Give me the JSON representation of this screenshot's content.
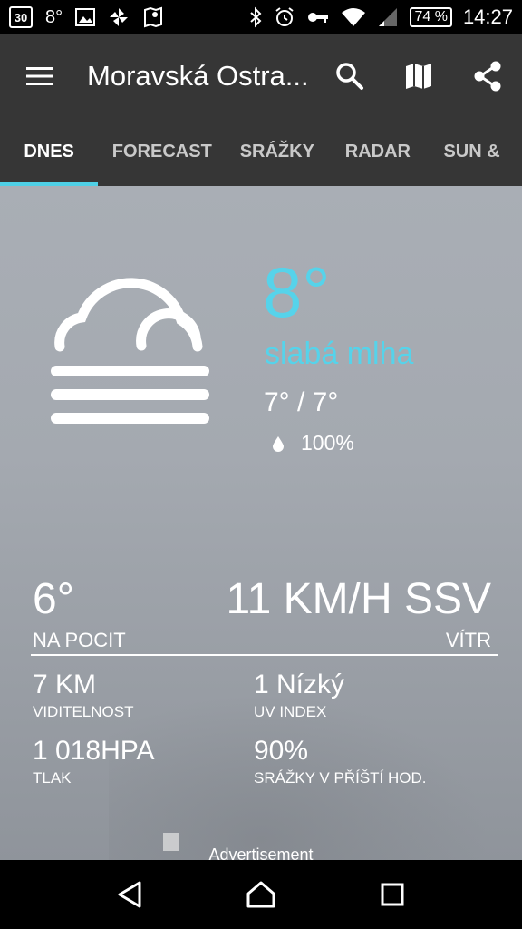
{
  "status_bar": {
    "date_badge": "30",
    "temperature": "8°",
    "battery": "74 %",
    "time": "14:27"
  },
  "app_bar": {
    "title": "Moravská Ostra...",
    "menu_icon": "hamburger-menu-icon",
    "actions": [
      "search-icon",
      "map-icon",
      "share-icon"
    ]
  },
  "tabs": [
    {
      "label": "DNES",
      "active": true
    },
    {
      "label": "FORECAST",
      "active": false
    },
    {
      "label": "SRÁŽKY",
      "active": false
    },
    {
      "label": "RADAR",
      "active": false
    },
    {
      "label": "SUN &",
      "active": false
    }
  ],
  "current": {
    "icon": "fog-cloud-icon",
    "temperature": "8°",
    "condition": "slabá mlha",
    "min_max": "7° / 7°",
    "precipitation": "100%"
  },
  "details": {
    "feels_like": {
      "value": "6°",
      "label": "NA POCIT"
    },
    "wind": {
      "value": "11 KM/H SSV",
      "label": "VÍTR"
    },
    "visibility": {
      "value": "7 KM",
      "label": "VIDITELNOST"
    },
    "uv": {
      "value": "1 Nízký",
      "label": "UV INDEX"
    },
    "pressure": {
      "value": "1 018HPA",
      "label": "TLAK"
    },
    "precip_next": {
      "value": "90%",
      "label": "SRÁŽKY V PŘÍŠTÍ HOD."
    }
  },
  "ad_label": "Advertisement",
  "colors": {
    "accent": "#56d3ea",
    "toolbar": "#363636",
    "tab_indicator": "#4fd0e6"
  }
}
